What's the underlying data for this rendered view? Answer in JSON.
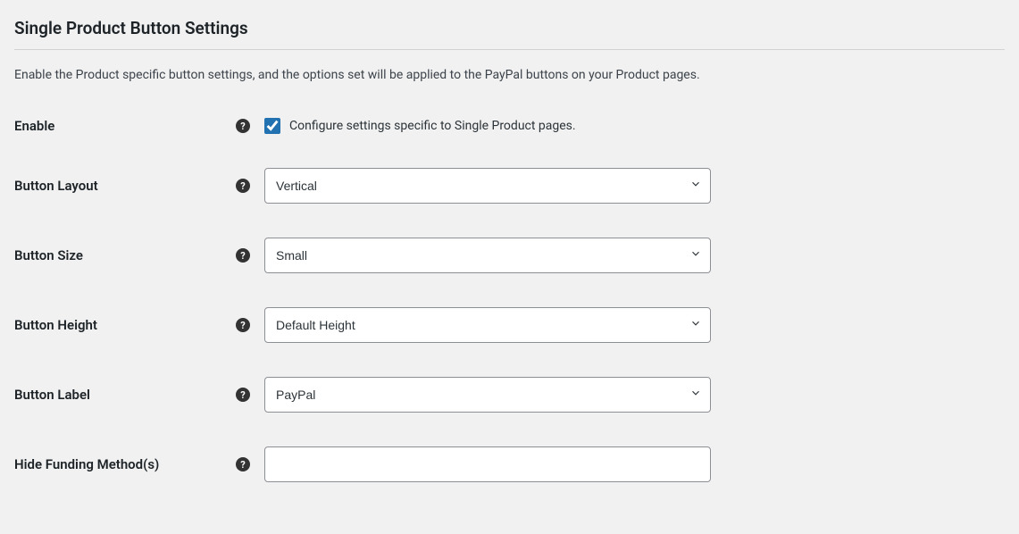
{
  "section": {
    "title": "Single Product Button Settings",
    "description": "Enable the Product specific button settings, and the options set will be applied to the PayPal buttons on your Product pages."
  },
  "fields": {
    "enable": {
      "label": "Enable",
      "checkbox_label": "Configure settings specific to Single Product pages.",
      "checked": true
    },
    "button_layout": {
      "label": "Button Layout",
      "value": "Vertical"
    },
    "button_size": {
      "label": "Button Size",
      "value": "Small"
    },
    "button_height": {
      "label": "Button Height",
      "value": "Default Height"
    },
    "button_label": {
      "label": "Button Label",
      "value": "PayPal"
    },
    "hide_funding": {
      "label": "Hide Funding Method(s)",
      "value": ""
    }
  },
  "help_glyph": "?"
}
